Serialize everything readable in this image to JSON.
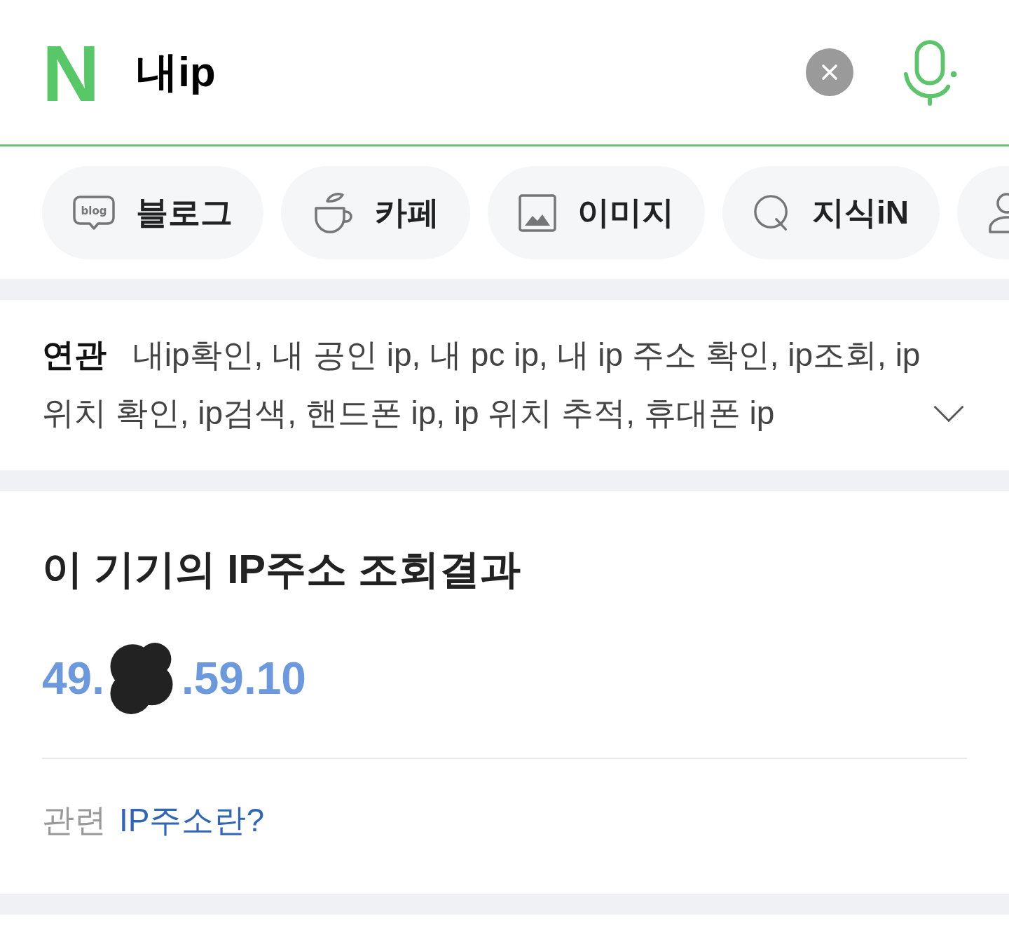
{
  "search_bar": {
    "logo": "N",
    "query": "내ip"
  },
  "tabs": [
    {
      "kind": "blog",
      "icon_text": "blog",
      "label": "블로그"
    },
    {
      "kind": "cafe",
      "label": "카페"
    },
    {
      "kind": "image",
      "label": "이미지"
    },
    {
      "kind": "kin",
      "label": "지식iN"
    },
    {
      "kind": "person"
    }
  ],
  "related_searches": {
    "text": "**연관** 내ip확인, 내 공인 ip, 내 pc ip, 내 ip 주소 확인, ip조회, ip 위치 확인, ip검색, 핸드폰 ip, ip 위치 추적, 휴대폰 ip",
    "expanded": false
  },
  "ip_result": {
    "title": "이 기기의 IP주소 조회결과",
    "ip_before_redaction": "49.",
    "ip_after_redaction": ".59.10",
    "related_label": "관련",
    "related_link": "IP주소란?"
  }
}
